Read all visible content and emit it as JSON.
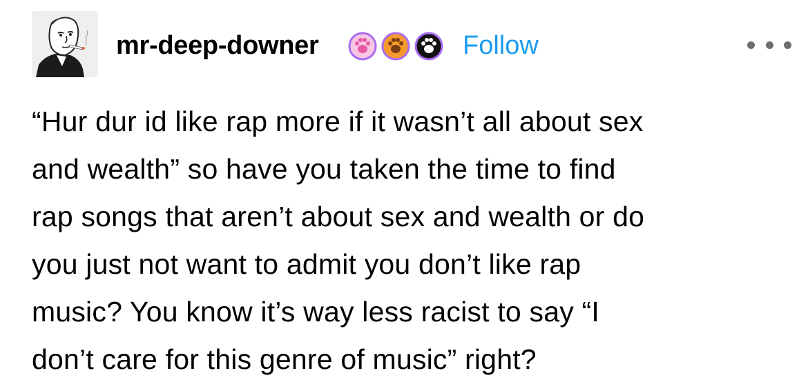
{
  "post": {
    "author": {
      "username": "mr-deep-downer",
      "avatar_icon": "wojak-smoking-avatar",
      "badges": [
        {
          "icon": "paw-badge-pink",
          "color": "#e85aa8",
          "bg": "#f7c6e3"
        },
        {
          "icon": "paw-badge-orange",
          "color": "#7a3d12",
          "bg": "#f59a2c"
        },
        {
          "icon": "paw-badge-black",
          "color": "#ffffff",
          "bg": "#111111"
        }
      ],
      "badge_ring_color": "#a86cf0"
    },
    "follow_label": "Follow",
    "follow_color": "#1a9cf0",
    "more_icon": "ellipsis-icon",
    "body_lines": [
      "“Hur dur id like rap more if it wasn’t all about sex",
      "and wealth” so have you taken the time to find",
      "rap songs that aren’t about sex and wealth or do",
      "you just not want to admit you don’t like rap",
      "music? You know it’s way less racist to say “I",
      "don’t care for this genre of music” right?"
    ]
  }
}
